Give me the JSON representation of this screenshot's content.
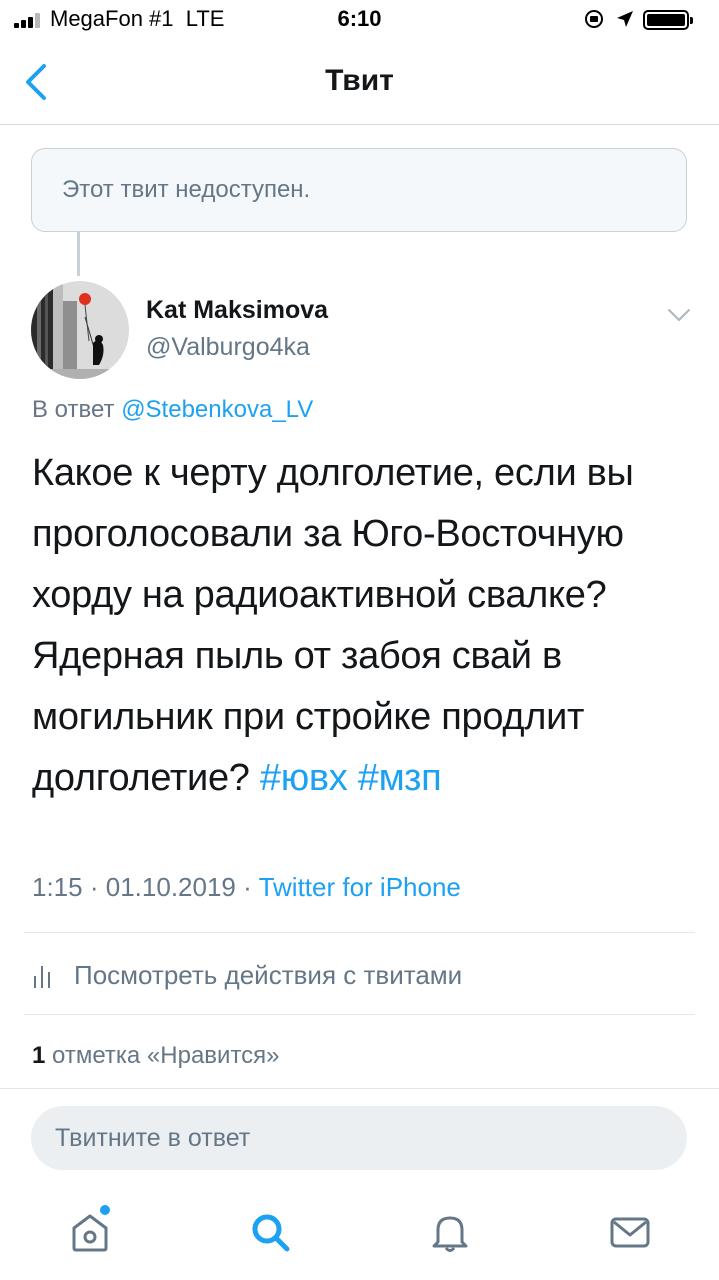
{
  "status_bar": {
    "carrier": "MegaFon #1",
    "network": "LTE",
    "time": "6:10"
  },
  "nav": {
    "title": "Твит",
    "back_icon": "chevron-left-icon"
  },
  "unavailable_tweet": {
    "text": "Этот твит недоступен."
  },
  "tweet": {
    "author_name": "Kat Maksimova",
    "author_handle": "@Valburgo4ka",
    "reply_prefix": "В ответ",
    "reply_to": "@Stebenkova_LV",
    "body": "Какое к черту долголетие, если вы проголосовали за Юго-Восточную хорду на радиоактивной свалке? Ядерная пыль от забоя свай в могильник при стройке продлит долголетие?",
    "hashtags": [
      "#ювх",
      "#мзп"
    ],
    "time": "1:15",
    "date": "01.10.2019",
    "source": "Twitter for iPhone",
    "separator": "·"
  },
  "activity": {
    "label": "Посмотреть действия с твитами"
  },
  "likes": {
    "count": "1",
    "label": "отметка «Нравится»"
  },
  "reply": {
    "placeholder": "Твитните в ответ"
  },
  "tab_bar": {
    "items": [
      "home-icon",
      "search-icon",
      "notifications-icon",
      "messages-icon"
    ],
    "active": "search-icon"
  },
  "colors": {
    "accent": "#1da1f2",
    "secondary_text": "#657786",
    "primary_text": "#14171a"
  }
}
